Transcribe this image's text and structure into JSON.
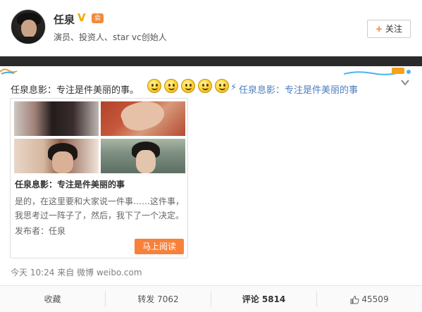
{
  "profile": {
    "name": "任泉",
    "verified_badge": "V",
    "vip_badge": "会",
    "bio": "演员、投资人、star vc创始人",
    "follow_label": "关注",
    "follow_plus": "+"
  },
  "post": {
    "text": "任泉息影：专注是件美丽的事。",
    "emoji_icon": "smile-emoji",
    "link_icon": "⚡",
    "link_text": "任泉息影：专注是件美丽的事"
  },
  "article": {
    "title": "任泉息影：专注是件美丽的事",
    "summary": "是的，在这里要和大家说一件事……这件事，我思考过一阵子了，然后，我下了一个决定。",
    "publisher": "发布者：任泉",
    "read_button": "马上阅读"
  },
  "meta": {
    "timestamp": "今天 10:24 来自 微博 weibo.com"
  },
  "actions": {
    "favorite": "收藏",
    "repost": "转发 7062",
    "comment": "评论 5814",
    "like": "45509"
  },
  "colors": {
    "link": "#4d7ec1",
    "accent_orange": "#f7813a",
    "verified_gold": "#f4a800"
  }
}
